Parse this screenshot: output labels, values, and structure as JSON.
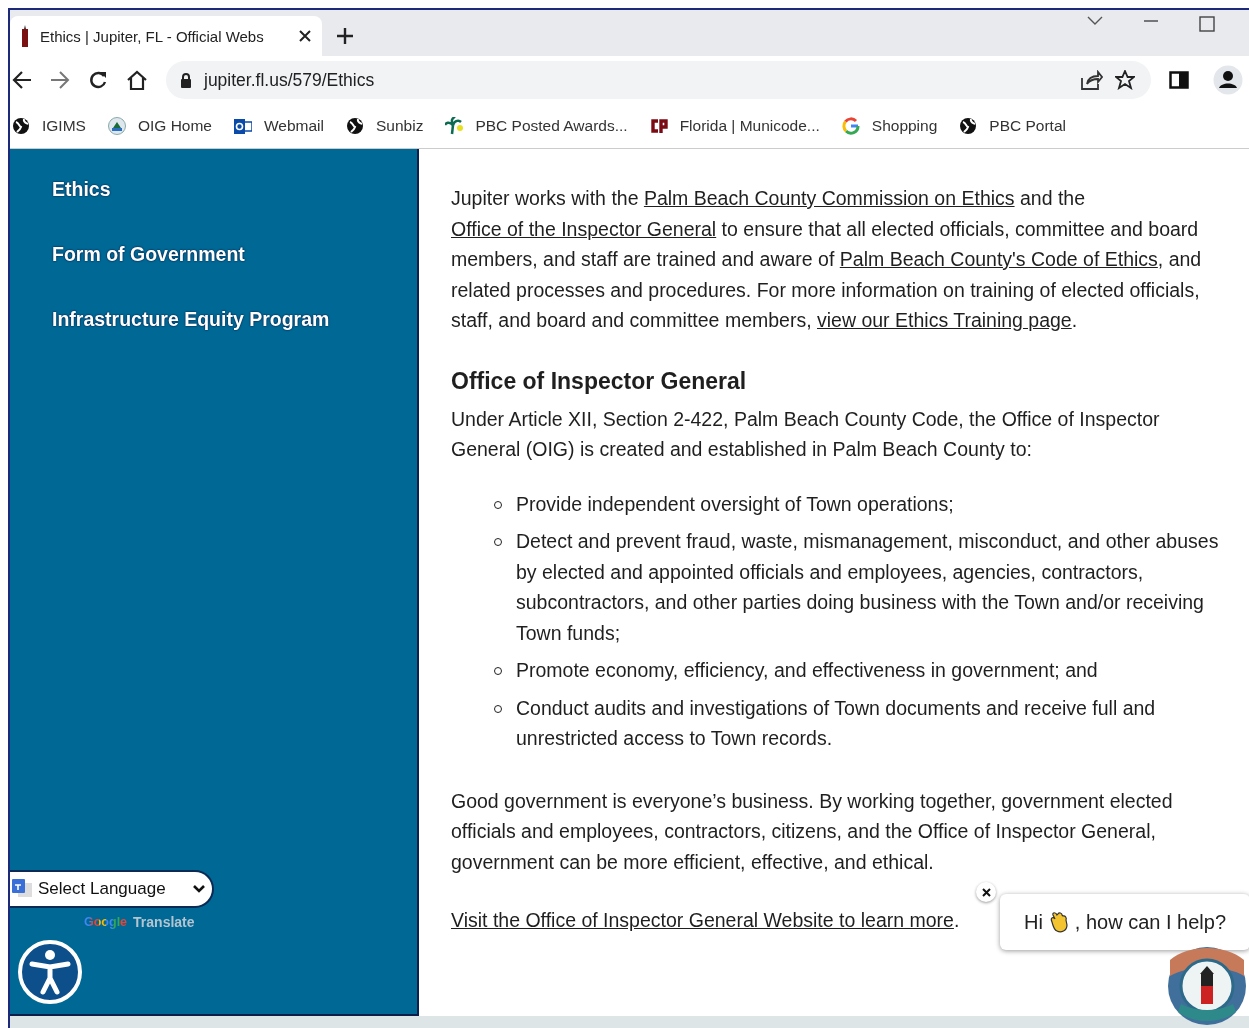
{
  "browser": {
    "tabs": [
      {
        "title": "Ethics | Jupiter, FL - Official Webs",
        "selected": true
      }
    ],
    "url": "jupiter.fl.us/579/Ethics"
  },
  "bookmarks": [
    {
      "label": "IGIMS",
      "kind": "globe"
    },
    {
      "label": "OIG Home",
      "kind": "seal"
    },
    {
      "label": "Webmail",
      "kind": "mail"
    },
    {
      "label": "Sunbiz",
      "kind": "globe"
    },
    {
      "label": "PBC Posted Awards...",
      "kind": "palm"
    },
    {
      "label": "Florida | Municode...",
      "kind": "municode"
    },
    {
      "label": "Shopping",
      "kind": "google"
    },
    {
      "label": "PBC Portal",
      "kind": "globe"
    }
  ],
  "sidebar": {
    "items": [
      {
        "label": "Ethics"
      },
      {
        "label": "Form of Government"
      },
      {
        "label": "Infrastructure Equity Program"
      }
    ],
    "language_select": {
      "value": "Select Language"
    },
    "translate": {
      "brand": "Google",
      "label": "Translate"
    }
  },
  "content": {
    "blocks": [
      {
        "kind": "paragraph",
        "segments": [
          {
            "kind": "text",
            "text": "Jupiter works with the "
          },
          {
            "kind": "link",
            "text": "Palm Beach County Commission on Ethics"
          },
          {
            "kind": "text",
            "text": " and the "
          },
          {
            "kind": "link",
            "text": "Office of the Inspector General"
          },
          {
            "kind": "text",
            "text": " to ensure that all elected officials, committee and board members, and staff are trained and aware of "
          },
          {
            "kind": "link",
            "text": "Palm Beach County's Code of Ethics"
          },
          {
            "kind": "text",
            "text": ", and related processes and procedures. For more information on training of elected officials, staff, and board and committee members, "
          },
          {
            "kind": "link",
            "text": "view our Ethics Training page"
          },
          {
            "kind": "text",
            "text": "."
          }
        ]
      },
      {
        "kind": "heading",
        "text": "Office of Inspector General"
      },
      {
        "kind": "lead",
        "text": "Under Article XII, Section 2-422, Palm Beach County Code, the Office of Inspector General (OIG) is created and established in Palm Beach County to:"
      },
      {
        "kind": "list",
        "items": [
          "Provide independent oversight of Town operations;",
          "Detect and prevent fraud, waste, mismanagement, misconduct, and other abuses by elected and appointed officials and employees, agencies, contractors, subcontractors, and other parties doing business with the Town and/or receiving Town funds;",
          "Promote economy, efficiency, and effectiveness in government; and",
          "Conduct audits and investigations of Town documents and receive full and unrestricted access to Town records."
        ]
      },
      {
        "kind": "paragraph",
        "segments": [
          {
            "kind": "text",
            "text": "Good government is everyone’s business. By working together, government elected officials and employees, contractors, citizens, and the Office of Inspector General, government can be more efficient, effective, and ethical."
          }
        ]
      },
      {
        "kind": "paragraph",
        "segments": [
          {
            "kind": "link",
            "text": "Visit the Office of Inspector General Website to learn more"
          },
          {
            "kind": "text",
            "text": "."
          }
        ]
      }
    ]
  },
  "chat": {
    "greeting_start": "Hi",
    "greeting_end": ", how can I help?"
  }
}
